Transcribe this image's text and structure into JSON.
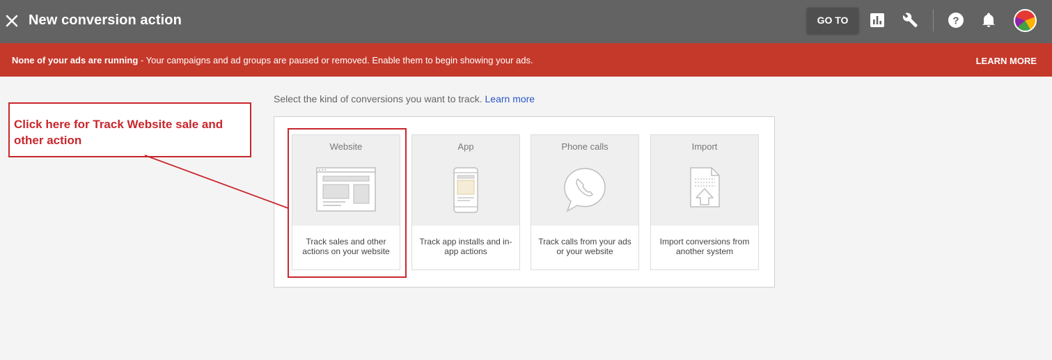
{
  "header": {
    "title": "New conversion action",
    "goto_label": "GO TO",
    "icons": [
      "close-icon",
      "reports-icon",
      "tools-wrench-icon",
      "help-icon",
      "notifications-bell-icon",
      "account-avatar"
    ]
  },
  "banner": {
    "bold": "None of your ads are running",
    "text": " - Your campaigns and ad groups are paused or removed. Enable them to begin showing your ads.",
    "action": "LEARN MORE",
    "color": "#c5392b"
  },
  "main": {
    "prompt": "Select the kind of conversions you want to track.",
    "learn_more": "Learn more",
    "cards": [
      {
        "name": "Website",
        "desc": "Track sales and other actions on your website",
        "icon": "website-icon"
      },
      {
        "name": "App",
        "desc": "Track app installs and in-app actions",
        "icon": "phone-app-icon"
      },
      {
        "name": "Phone calls",
        "desc": "Track calls from your ads or your website",
        "icon": "phone-call-icon"
      },
      {
        "name": "Import",
        "desc": "Import conversions from another system",
        "icon": "import-document-icon"
      }
    ]
  },
  "annotation": {
    "text": "Click here for Track Website sale and other action",
    "color": "#c8262c"
  }
}
